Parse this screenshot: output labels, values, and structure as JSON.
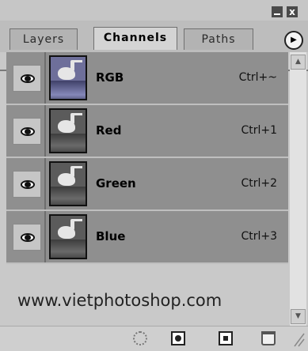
{
  "window": {
    "minimize_label": "",
    "close_label": "x"
  },
  "tabs": [
    {
      "label": "Layers",
      "active": false
    },
    {
      "label": "Channels",
      "active": true
    },
    {
      "label": "Paths",
      "active": false
    }
  ],
  "menu_icon": "play-right-arrow",
  "channels": [
    {
      "name": "RGB",
      "shortcut": "Ctrl+~",
      "visible": true,
      "thumb": "color"
    },
    {
      "name": "Red",
      "shortcut": "Ctrl+1",
      "visible": true,
      "thumb": "gray"
    },
    {
      "name": "Green",
      "shortcut": "Ctrl+2",
      "visible": true,
      "thumb": "gray"
    },
    {
      "name": "Blue",
      "shortcut": "Ctrl+3",
      "visible": true,
      "thumb": "gray"
    }
  ],
  "watermark": "www.vietphotoshop.com",
  "bottom_tools": [
    {
      "icon": "load-selection-icon"
    },
    {
      "icon": "save-selection-icon"
    },
    {
      "icon": "new-channel-icon"
    },
    {
      "icon": "trash-icon"
    }
  ],
  "colors": {
    "row_bg": "#8f8f8f",
    "panel_bg": "#c9c9c9"
  }
}
